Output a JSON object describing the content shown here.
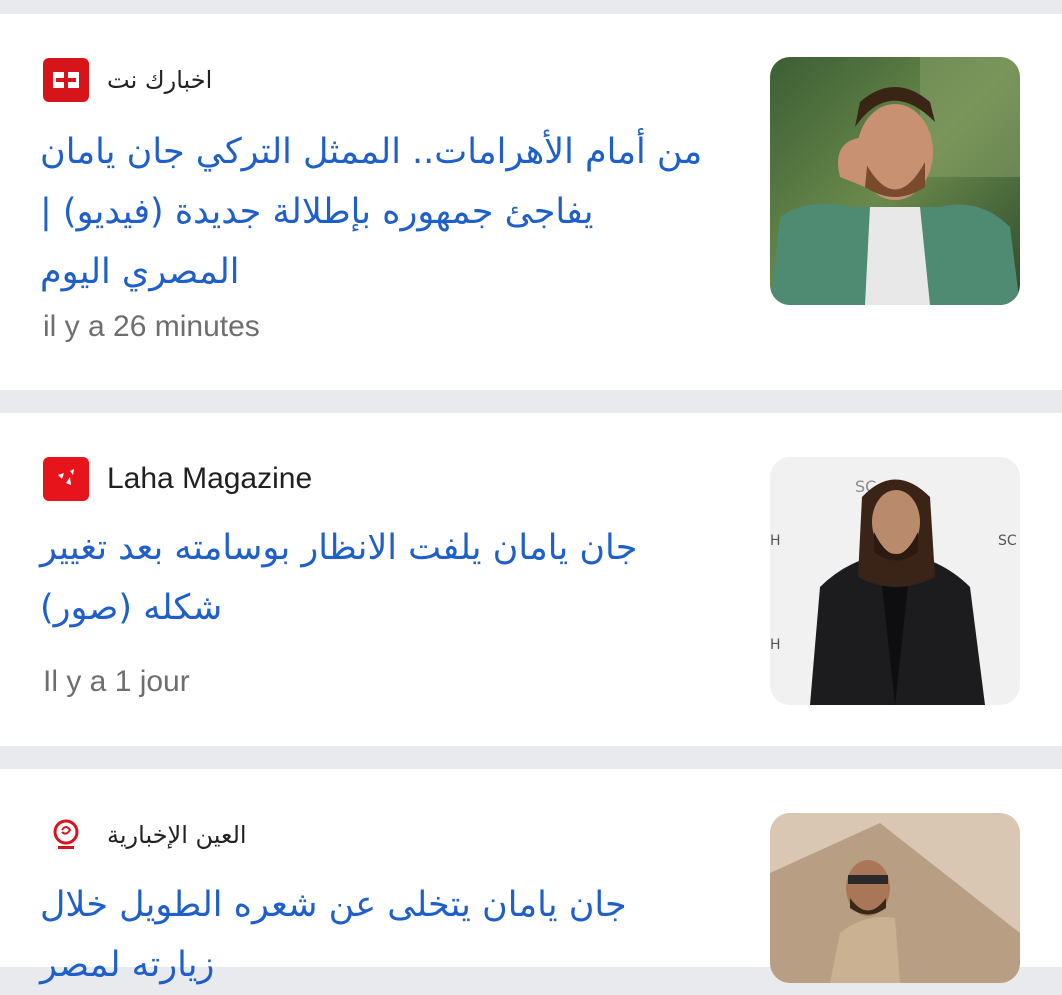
{
  "articles": [
    {
      "source": "اخبارك نت",
      "source_icon": "akhbarak-logo-icon",
      "headline": "من أمام الأهرامات.. الممثل التركي جان يامان يفاجئ جمهوره بإطلالة جديدة (فيديو) | المصري اليوم",
      "time": "il y a 26 minutes",
      "thumbnail": "man-green-jacket-photo"
    },
    {
      "source": "Laha Magazine",
      "source_icon": "laha-logo-icon",
      "headline": "جان يامان يلفت الانظار بوسامته بعد تغيير شكله (صور)",
      "time": "Il y a 1 jour",
      "thumbnail": "man-black-suit-photo"
    },
    {
      "source": "العين الإخبارية",
      "source_icon": "alain-logo-icon",
      "headline": "جان يامان يتخلى عن شعره الطويل خلال زيارته لمصر",
      "time": "",
      "thumbnail": "man-pyramids-photo"
    }
  ],
  "colors": {
    "headline": "#1f5fc9",
    "source_text": "#222222",
    "time_text": "#6e6e6e",
    "separator": "#e9eaee"
  }
}
